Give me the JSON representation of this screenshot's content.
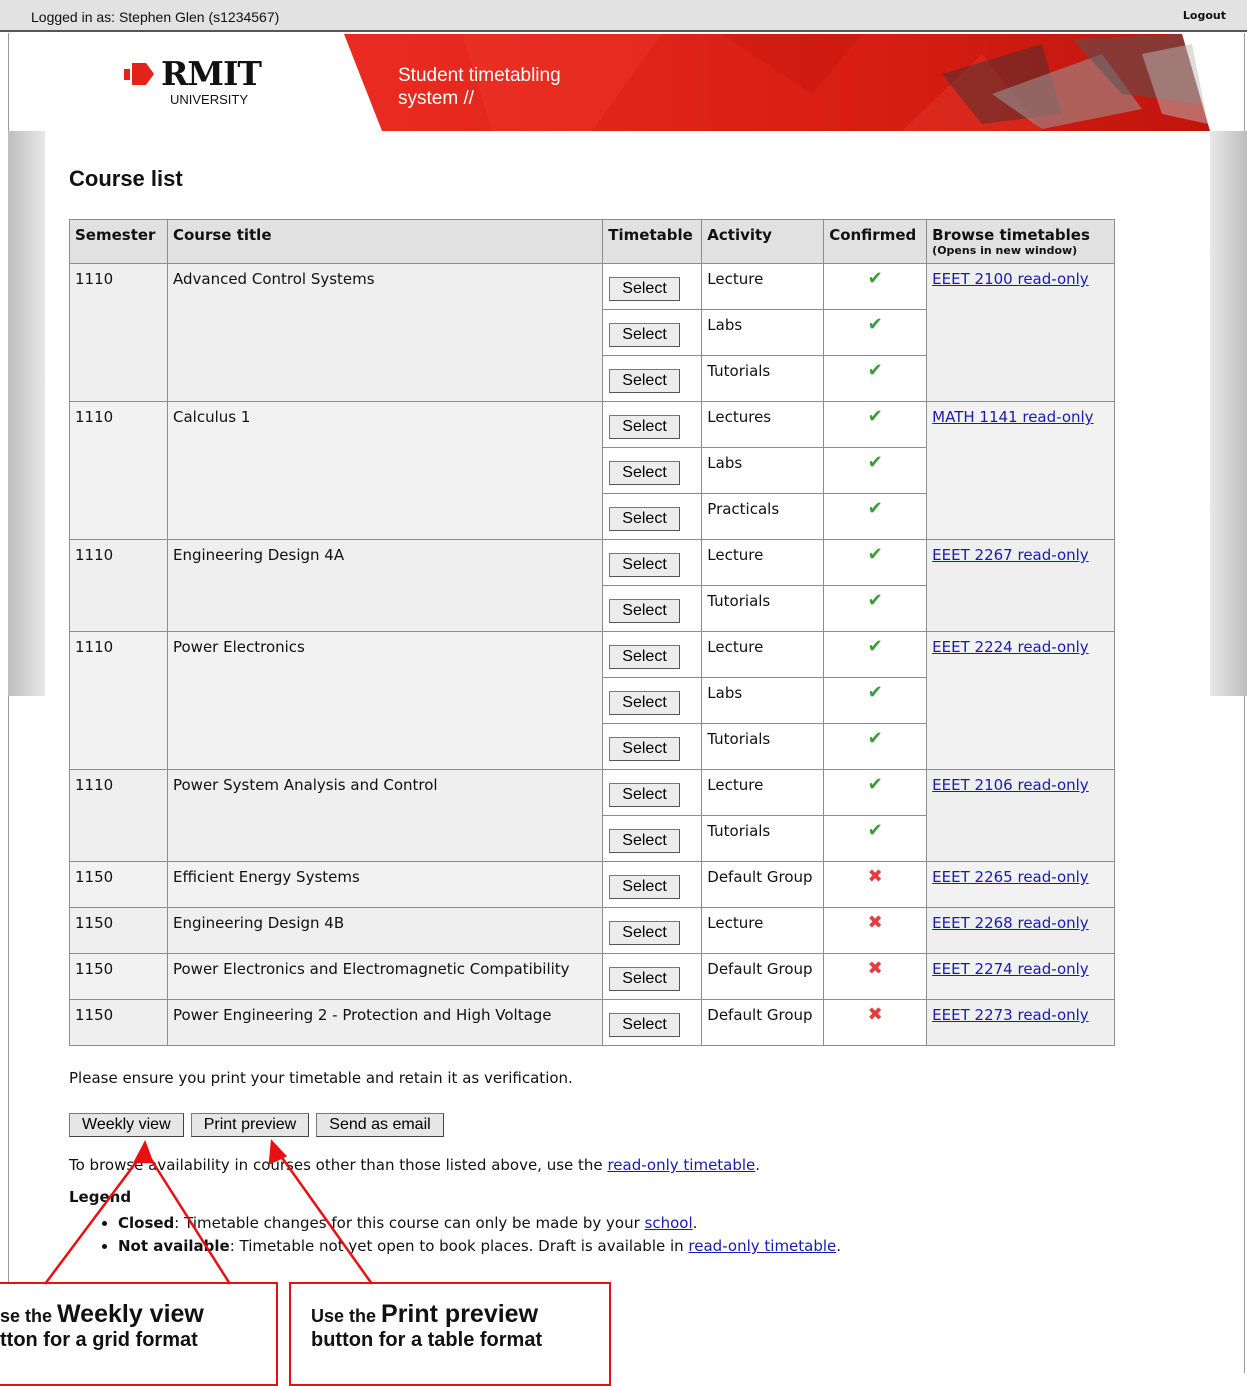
{
  "header": {
    "login_text": "Logged in as: Stephen Glen (s1234567)",
    "logout_label": "Logout"
  },
  "logo": {
    "name": "RMIT",
    "sub": "UNIVERSITY"
  },
  "banner": {
    "line1": "Student timetabling",
    "line2": "system //"
  },
  "page_title": "Course list",
  "table": {
    "headers": {
      "semester": "Semester",
      "course_title": "Course title",
      "timetable": "Timetable",
      "activity": "Activity",
      "confirmed": "Confirmed",
      "browse": "Browse timetables",
      "browse_sub": "(Opens in new window)"
    },
    "select_label": "Select",
    "courses": [
      {
        "semester": "1110",
        "title": "Advanced Control Systems",
        "link": "EEET 2100 read-only",
        "activities": [
          {
            "name": "Lecture",
            "confirmed": true
          },
          {
            "name": "Labs",
            "confirmed": true
          },
          {
            "name": "Tutorials",
            "confirmed": true
          }
        ]
      },
      {
        "semester": "1110",
        "title": "Calculus 1",
        "link": "MATH 1141 read-only",
        "activities": [
          {
            "name": "Lectures",
            "confirmed": true
          },
          {
            "name": "Labs",
            "confirmed": true
          },
          {
            "name": "Practicals",
            "confirmed": true
          }
        ]
      },
      {
        "semester": "1110",
        "title": "Engineering Design 4A",
        "link": "EEET 2267 read-only",
        "activities": [
          {
            "name": "Lecture",
            "confirmed": true
          },
          {
            "name": "Tutorials",
            "confirmed": true
          }
        ]
      },
      {
        "semester": "1110",
        "title": "Power Electronics",
        "link": "EEET 2224 read-only",
        "activities": [
          {
            "name": "Lecture",
            "confirmed": true
          },
          {
            "name": "Labs",
            "confirmed": true
          },
          {
            "name": "Tutorials",
            "confirmed": true
          }
        ]
      },
      {
        "semester": "1110",
        "title": "Power System Analysis and Control",
        "link": "EEET 2106 read-only",
        "activities": [
          {
            "name": "Lecture",
            "confirmed": true
          },
          {
            "name": "Tutorials",
            "confirmed": true
          }
        ]
      },
      {
        "semester": "1150",
        "title": "Efficient Energy Systems",
        "link": "EEET 2265 read-only",
        "activities": [
          {
            "name": "Default Group",
            "confirmed": false
          }
        ]
      },
      {
        "semester": "1150",
        "title": "Engineering Design 4B",
        "link": "EEET 2268 read-only",
        "activities": [
          {
            "name": "Lecture",
            "confirmed": false
          }
        ]
      },
      {
        "semester": "1150",
        "title": "Power Electronics and Electromagnetic Compatibility",
        "link": "EEET 2274 read-only",
        "activities": [
          {
            "name": "Default Group",
            "confirmed": false
          }
        ]
      },
      {
        "semester": "1150",
        "title": "Power Engineering 2 - Protection and High Voltage",
        "link": "EEET 2273 read-only",
        "activities": [
          {
            "name": "Default Group",
            "confirmed": false
          }
        ]
      }
    ]
  },
  "notice": "Please ensure you print your timetable and retain it as verification.",
  "buttons": {
    "weekly": "Weekly view",
    "print": "Print preview",
    "email": "Send as email"
  },
  "browse_info": {
    "before": "To browse availability in courses other than those listed above, use the ",
    "link": "read-only timetable",
    "after": "."
  },
  "legend": {
    "title": "Legend",
    "closed_term": "Closed",
    "closed_text": ": Timetable changes for this course can only be made by your ",
    "closed_link": "school",
    "closed_end": ".",
    "na_term": "Not available",
    "na_text": ": Timetable not yet open to book places. Draft is available in ",
    "na_link": "read-only timetable",
    "na_end": "."
  },
  "callouts": {
    "weekly": {
      "pre": "se the ",
      "strong": "Weekly view",
      "line2": "tton for a grid format"
    },
    "print": {
      "pre": "Use the ",
      "strong": "Print preview",
      "line2": "button for a table format"
    }
  },
  "colors": {
    "accent_red": "#e2231a",
    "confirm_green": "#3c9c3c",
    "cross_red": "#e43d3d",
    "link_blue": "#1a1ab0"
  },
  "icons": {
    "confirmed": "check-icon",
    "not_confirmed": "cross-icon"
  }
}
